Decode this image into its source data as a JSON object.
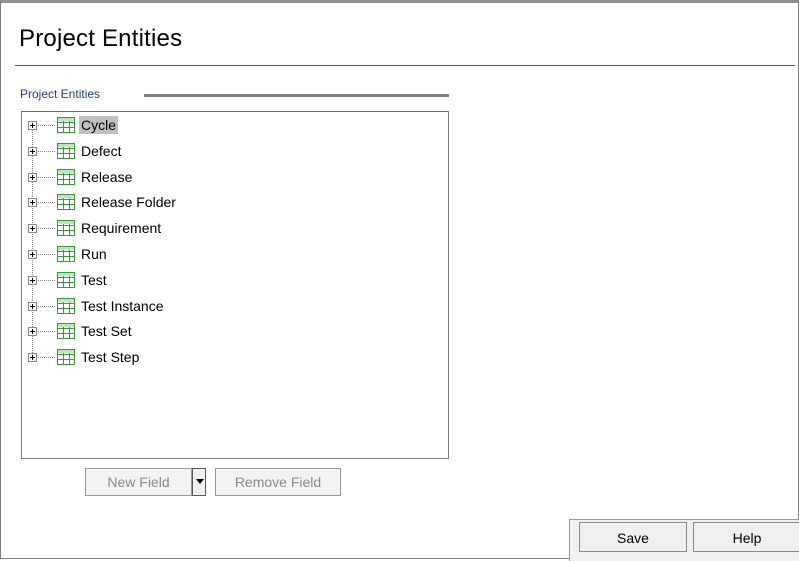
{
  "page": {
    "title": "Project Entities"
  },
  "group": {
    "label": "Project Entities"
  },
  "tree": {
    "items": [
      {
        "label": "Cycle",
        "selected": true,
        "icon": "entity-table-icon"
      },
      {
        "label": "Defect",
        "selected": false,
        "icon": "entity-table-icon"
      },
      {
        "label": "Release",
        "selected": false,
        "icon": "entity-table-icon"
      },
      {
        "label": "Release Folder",
        "selected": false,
        "icon": "entity-table-icon"
      },
      {
        "label": "Requirement",
        "selected": false,
        "icon": "entity-table-icon"
      },
      {
        "label": "Run",
        "selected": false,
        "icon": "entity-table-icon"
      },
      {
        "label": "Test",
        "selected": false,
        "icon": "entity-table-icon"
      },
      {
        "label": "Test Instance",
        "selected": false,
        "icon": "entity-table-icon"
      },
      {
        "label": "Test Set",
        "selected": false,
        "icon": "entity-table-icon"
      },
      {
        "label": "Test Step",
        "selected": false,
        "icon": "entity-table-icon"
      }
    ]
  },
  "actions": {
    "new_field": "New Field",
    "remove_field": "Remove Field"
  },
  "footer": {
    "save": "Save",
    "help": "Help"
  },
  "colors": {
    "selection": "#c0c0c0",
    "group_label": "#21407a",
    "icon_green": "#3a9a3a"
  }
}
